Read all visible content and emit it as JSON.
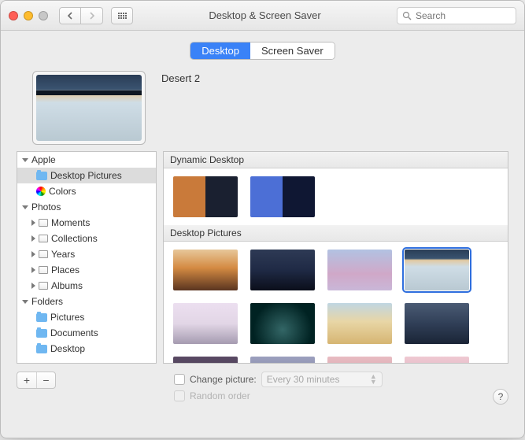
{
  "window": {
    "title": "Desktop & Screen Saver"
  },
  "search": {
    "placeholder": "Search"
  },
  "tabs": {
    "desktop": "Desktop",
    "screensaver": "Screen Saver"
  },
  "current": {
    "name": "Desert 2"
  },
  "sidebar": {
    "apple": "Apple",
    "desktop_pictures": "Desktop Pictures",
    "colors": "Colors",
    "photos": "Photos",
    "moments": "Moments",
    "collections": "Collections",
    "years": "Years",
    "places": "Places",
    "albums": "Albums",
    "folders": "Folders",
    "pictures": "Pictures",
    "documents": "Documents",
    "desktop": "Desktop"
  },
  "sections": {
    "dynamic": "Dynamic Desktop",
    "pictures": "Desktop Pictures"
  },
  "footer": {
    "change_label": "Change picture:",
    "interval": "Every 30 minutes",
    "random_label": "Random order",
    "help": "?"
  },
  "colors": {
    "traffic_close": "#ff5f57",
    "traffic_min": "#febc2e",
    "traffic_max": "#c7c7c7"
  }
}
